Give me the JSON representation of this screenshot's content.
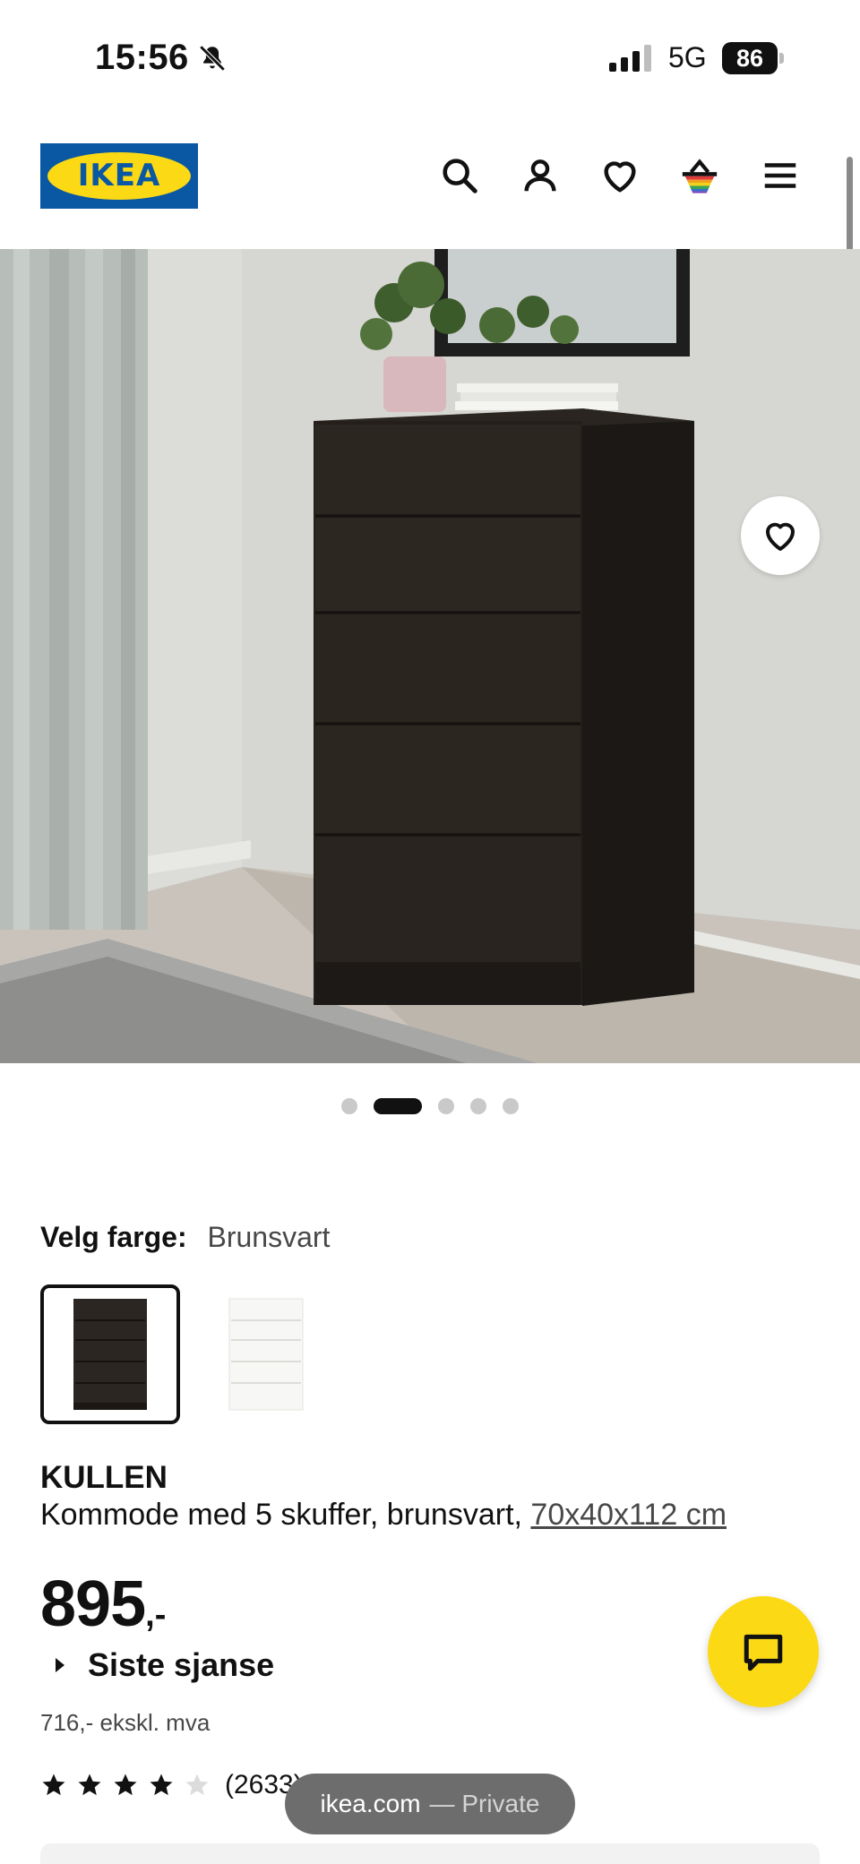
{
  "status_bar": {
    "time": "15:56",
    "network": "5G",
    "battery": "86",
    "icons": [
      "bell-slash-icon",
      "signal-icon",
      "battery-icon"
    ]
  },
  "header": {
    "logo_text": "IKEA",
    "icons": [
      "search-icon",
      "account-icon",
      "heart-icon",
      "basket-icon",
      "menu-icon"
    ],
    "brand_colors": {
      "blue": "#0a57a4",
      "yellow": "#fbd914"
    }
  },
  "gallery": {
    "current_index": 2,
    "total": 5,
    "favorite_icon": "heart-icon"
  },
  "color_picker": {
    "label": "Velg farge:",
    "selected_value": "Brunsvart",
    "options": [
      {
        "name": "black-brown",
        "color": "#2b2622",
        "selected": true
      },
      {
        "name": "white",
        "color": "#f4f4f2",
        "selected": false
      }
    ]
  },
  "product": {
    "name": "KULLEN",
    "description": "Kommode med 5 skuffer, brunsvart, ",
    "dimensions": "70x40x112 cm",
    "price_main": "895",
    "price_suffix": ",-",
    "badge": "Siste sjanse",
    "price_ex_vat": "716,- ekskl. mva",
    "rating": 4,
    "rating_max": 5,
    "review_count": "(2633)"
  },
  "chat": {
    "icon": "chat-icon",
    "color": "#fbd914"
  },
  "browser": {
    "domain": "ikea.com",
    "mode": "— Private"
  }
}
